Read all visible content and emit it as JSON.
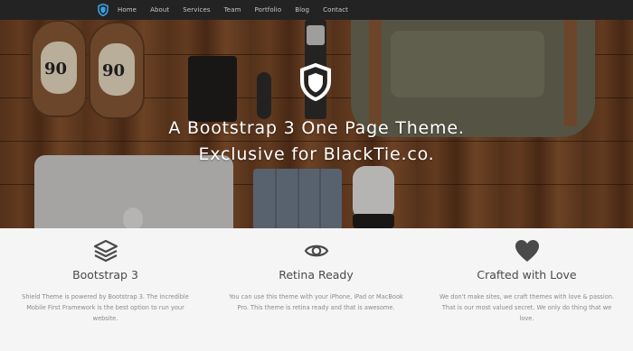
{
  "nav": {
    "brand_icon": "shield-icon",
    "items": [
      {
        "label": "Home"
      },
      {
        "label": "About"
      },
      {
        "label": "Services"
      },
      {
        "label": "Team"
      },
      {
        "label": "Portfolio"
      },
      {
        "label": "Blog"
      },
      {
        "label": "Contact"
      }
    ]
  },
  "hero": {
    "logo_icon": "shield-icon",
    "headline_line1": "A Bootstrap 3 One Page Theme.",
    "headline_line2": "Exclusive for BlackTie.co.",
    "shoe_number": "90"
  },
  "features": [
    {
      "icon": "layers-icon",
      "title": "Bootstrap 3",
      "text": "Shield Theme is powered by Bootstrap 3. The incredible Mobile First Framework is the best option to run your website."
    },
    {
      "icon": "eye-icon",
      "title": "Retina Ready",
      "text": "You can use this theme with your iPhone, iPad or MacBook Pro. This theme is retina ready and that is awesome."
    },
    {
      "icon": "heart-icon",
      "title": "Crafted with Love",
      "text": "We don't make sites, we craft themes with love & passion. That is our most valued secret. We only do thing that we love."
    }
  ],
  "colors": {
    "navbar": "#232323",
    "brand_accent": "#3aa0e0",
    "feature_icon": "#4a4a4a",
    "section_bg": "#f5f5f5"
  }
}
